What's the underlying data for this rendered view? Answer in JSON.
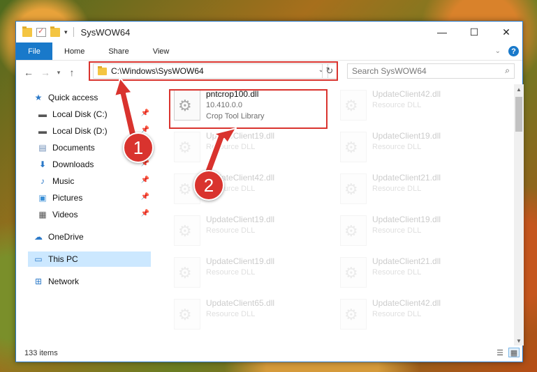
{
  "window": {
    "title": "SysWOW64",
    "controls": {
      "minimize": "—",
      "maximize": "☐",
      "close": "✕"
    }
  },
  "ribbon": {
    "tabs": [
      "File",
      "Home",
      "Share",
      "View"
    ],
    "help": "?"
  },
  "nav": {
    "address": "C:\\Windows\\SysWOW64",
    "search_placeholder": "Search SysWOW64"
  },
  "sidebar": {
    "items": [
      {
        "label": "Quick access",
        "icon": "star-icon"
      },
      {
        "label": "Local Disk (C:)",
        "icon": "drive-icon"
      },
      {
        "label": "Local Disk (D:)",
        "icon": "drive-icon"
      },
      {
        "label": "Documents",
        "icon": "documents-icon"
      },
      {
        "label": "Downloads",
        "icon": "download-icon"
      },
      {
        "label": "Music",
        "icon": "music-icon"
      },
      {
        "label": "Pictures",
        "icon": "pictures-icon"
      },
      {
        "label": "Videos",
        "icon": "videos-icon"
      },
      {
        "label": "OneDrive",
        "icon": "cloud-icon"
      },
      {
        "label": "This PC",
        "icon": "computer-icon"
      },
      {
        "label": "Network",
        "icon": "network-icon"
      }
    ]
  },
  "files": [
    {
      "name": "pntcrop100.dll",
      "line2": "10.410.0.0",
      "line3": "Crop Tool Library"
    },
    {
      "name": "UpdateClient42.dll",
      "line2": "Resource DLL"
    },
    {
      "name": "UpdateClient19.dll",
      "line2": "Resource DLL"
    },
    {
      "name": "UpdateClient19.dll",
      "line2": "Resource DLL"
    },
    {
      "name": "UpdateClient42.dll",
      "line2": "Resource DLL"
    },
    {
      "name": "UpdateClient21.dll",
      "line2": "Resource DLL"
    },
    {
      "name": "UpdateClient19.dll",
      "line2": "Resource DLL"
    },
    {
      "name": "UpdateClient19.dll",
      "line2": "Resource DLL"
    },
    {
      "name": "UpdateClient19.dll",
      "line2": "Resource DLL"
    },
    {
      "name": "UpdateClient21.dll",
      "line2": "Resource DLL"
    },
    {
      "name": "UpdateClient65.dll",
      "line2": "Resource DLL"
    },
    {
      "name": "UpdateClient42.dll",
      "line2": "Resource DLL"
    }
  ],
  "status": {
    "item_count": "133 items"
  },
  "annotations": {
    "step1": "1",
    "step2": "2",
    "color": "#d9332e"
  }
}
